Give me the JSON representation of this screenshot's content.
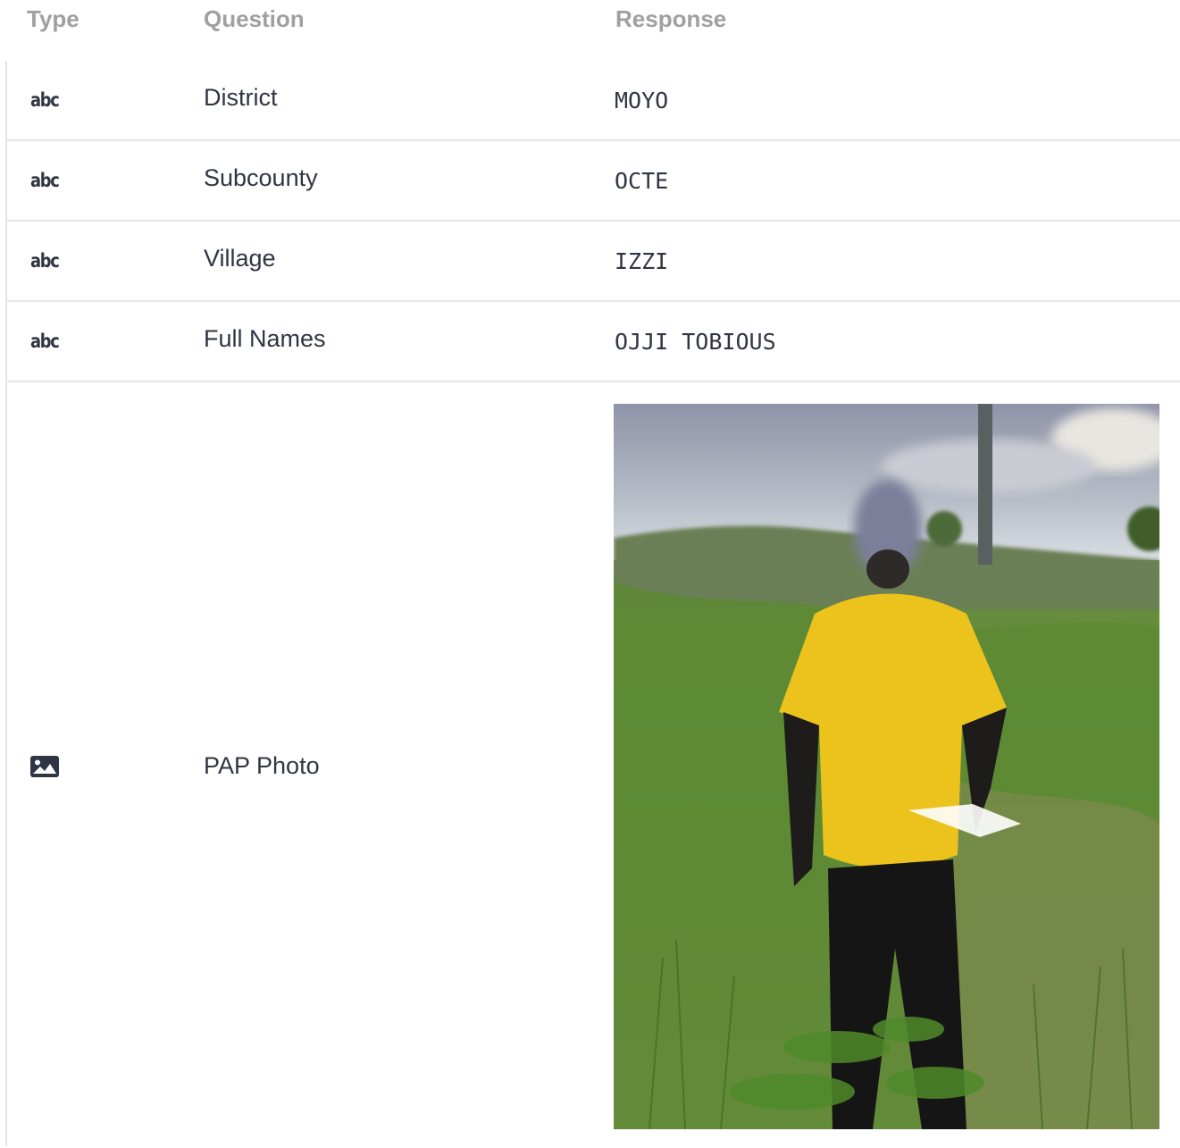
{
  "table": {
    "headers": {
      "type": "Type",
      "question": "Question",
      "response": "Response"
    },
    "rows": [
      {
        "type_label": "abc",
        "question": "District",
        "response": "MOYO"
      },
      {
        "type_label": "abc",
        "question": "Subcounty",
        "response": "OCTE"
      },
      {
        "type_label": "abc",
        "question": "Village",
        "response": "IZZI"
      },
      {
        "type_label": "abc",
        "question": "Full Names",
        "response": "OJJI TOBIOUS"
      }
    ],
    "photo_row": {
      "type_icon": "image-icon",
      "question": "PAP Photo"
    }
  },
  "colors": {
    "header_text": "#a0a0a0",
    "body_text": "#2f3542",
    "rule": "#e6e6e6"
  }
}
